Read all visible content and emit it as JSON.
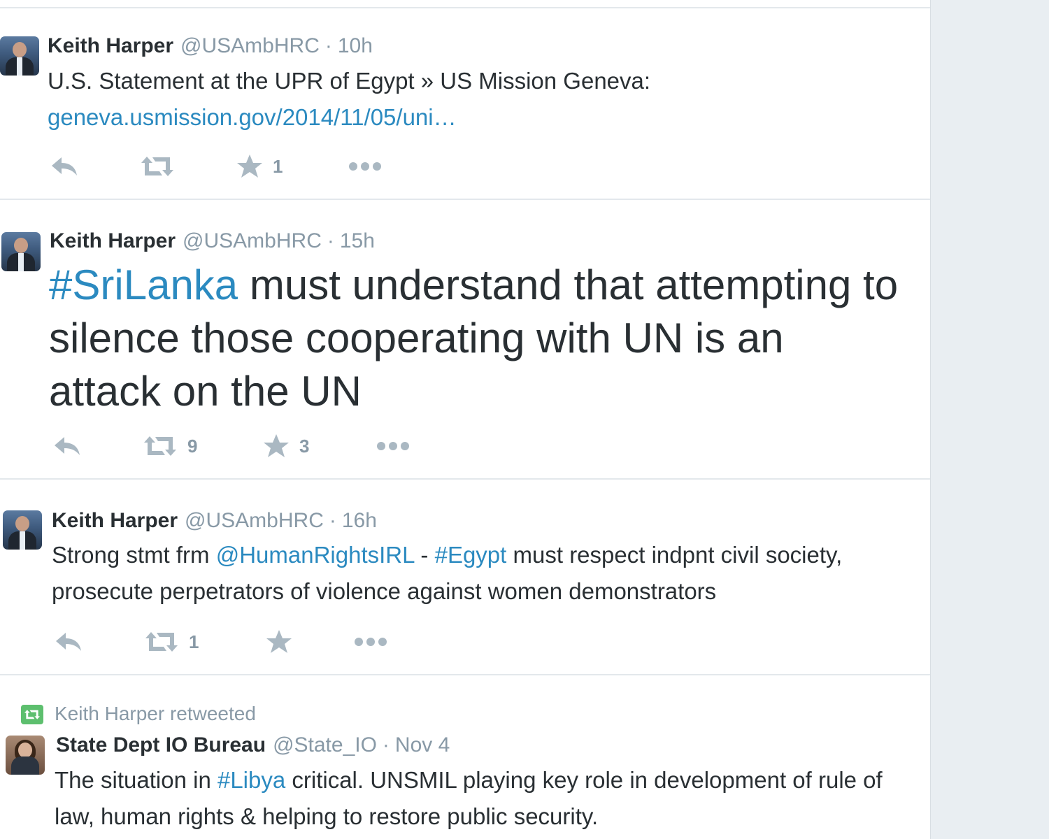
{
  "colors": {
    "link": "#2b8ac0",
    "name": "#292f33",
    "meta": "#8899a6",
    "icon": "#aab8c2",
    "retweet_badge": "#5dbf6e"
  },
  "tweets": [
    {
      "author": "Keith Harper",
      "handle": "@USAmbHRC",
      "separator": "·",
      "time": "10h",
      "text": "U.S. Statement at the UPR of Egypt » US Mission Geneva:",
      "link": "geneva.usmission.gov/2014/11/05/uni…",
      "retweets": "",
      "favorites": "1"
    },
    {
      "author": "Keith Harper",
      "handle": "@USAmbHRC",
      "separator": "·",
      "time": "15h",
      "hashtag": "#SriLanka",
      "text": " must understand that attempting to silence those cooperating with UN is an attack on the UN",
      "retweets": "9",
      "favorites": "3"
    },
    {
      "author": "Keith Harper",
      "handle": "@USAmbHRC",
      "separator": "·",
      "time": "16h",
      "text_a": "Strong stmt frm ",
      "mention": "@HumanRightsIRL",
      "text_b": " - ",
      "hashtag": "#Egypt",
      "text_c": " must respect indpnt civil society, prosecute perpetrators of violence against women demonstrators",
      "retweets": "1",
      "favorites": ""
    },
    {
      "retweeted_by": "Keith Harper retweeted",
      "author": "State Dept IO Bureau",
      "handle": "@State_IO",
      "separator": "·",
      "time": "Nov 4",
      "text_a": "The situation in ",
      "hashtag": "#Libya",
      "text_b": " critical. UNSMIL playing key role in development of rule of law, human rights & helping to restore public security."
    }
  ]
}
